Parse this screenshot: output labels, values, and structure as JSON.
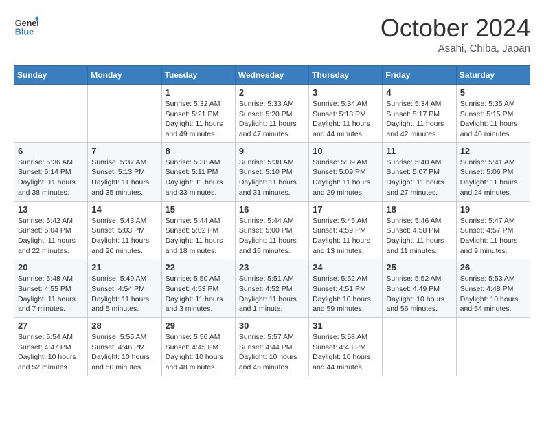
{
  "header": {
    "logo_line1": "General",
    "logo_line2": "Blue",
    "month_year": "October 2024",
    "location": "Asahi, Chiba, Japan"
  },
  "days_of_week": [
    "Sunday",
    "Monday",
    "Tuesday",
    "Wednesday",
    "Thursday",
    "Friday",
    "Saturday"
  ],
  "weeks": [
    [
      {
        "day": "",
        "sunrise": "",
        "sunset": "",
        "daylight": ""
      },
      {
        "day": "",
        "sunrise": "",
        "sunset": "",
        "daylight": ""
      },
      {
        "day": "1",
        "sunrise": "Sunrise: 5:32 AM",
        "sunset": "Sunset: 5:21 PM",
        "daylight": "Daylight: 11 hours and 49 minutes."
      },
      {
        "day": "2",
        "sunrise": "Sunrise: 5:33 AM",
        "sunset": "Sunset: 5:20 PM",
        "daylight": "Daylight: 11 hours and 47 minutes."
      },
      {
        "day": "3",
        "sunrise": "Sunrise: 5:34 AM",
        "sunset": "Sunset: 5:18 PM",
        "daylight": "Daylight: 11 hours and 44 minutes."
      },
      {
        "day": "4",
        "sunrise": "Sunrise: 5:34 AM",
        "sunset": "Sunset: 5:17 PM",
        "daylight": "Daylight: 11 hours and 42 minutes."
      },
      {
        "day": "5",
        "sunrise": "Sunrise: 5:35 AM",
        "sunset": "Sunset: 5:15 PM",
        "daylight": "Daylight: 11 hours and 40 minutes."
      }
    ],
    [
      {
        "day": "6",
        "sunrise": "Sunrise: 5:36 AM",
        "sunset": "Sunset: 5:14 PM",
        "daylight": "Daylight: 11 hours and 38 minutes."
      },
      {
        "day": "7",
        "sunrise": "Sunrise: 5:37 AM",
        "sunset": "Sunset: 5:13 PM",
        "daylight": "Daylight: 11 hours and 35 minutes."
      },
      {
        "day": "8",
        "sunrise": "Sunrise: 5:38 AM",
        "sunset": "Sunset: 5:11 PM",
        "daylight": "Daylight: 11 hours and 33 minutes."
      },
      {
        "day": "9",
        "sunrise": "Sunrise: 5:38 AM",
        "sunset": "Sunset: 5:10 PM",
        "daylight": "Daylight: 11 hours and 31 minutes."
      },
      {
        "day": "10",
        "sunrise": "Sunrise: 5:39 AM",
        "sunset": "Sunset: 5:09 PM",
        "daylight": "Daylight: 11 hours and 29 minutes."
      },
      {
        "day": "11",
        "sunrise": "Sunrise: 5:40 AM",
        "sunset": "Sunset: 5:07 PM",
        "daylight": "Daylight: 11 hours and 27 minutes."
      },
      {
        "day": "12",
        "sunrise": "Sunrise: 5:41 AM",
        "sunset": "Sunset: 5:06 PM",
        "daylight": "Daylight: 11 hours and 24 minutes."
      }
    ],
    [
      {
        "day": "13",
        "sunrise": "Sunrise: 5:42 AM",
        "sunset": "Sunset: 5:04 PM",
        "daylight": "Daylight: 11 hours and 22 minutes."
      },
      {
        "day": "14",
        "sunrise": "Sunrise: 5:43 AM",
        "sunset": "Sunset: 5:03 PM",
        "daylight": "Daylight: 11 hours and 20 minutes."
      },
      {
        "day": "15",
        "sunrise": "Sunrise: 5:44 AM",
        "sunset": "Sunset: 5:02 PM",
        "daylight": "Daylight: 11 hours and 18 minutes."
      },
      {
        "day": "16",
        "sunrise": "Sunrise: 5:44 AM",
        "sunset": "Sunset: 5:00 PM",
        "daylight": "Daylight: 11 hours and 16 minutes."
      },
      {
        "day": "17",
        "sunrise": "Sunrise: 5:45 AM",
        "sunset": "Sunset: 4:59 PM",
        "daylight": "Daylight: 11 hours and 13 minutes."
      },
      {
        "day": "18",
        "sunrise": "Sunrise: 5:46 AM",
        "sunset": "Sunset: 4:58 PM",
        "daylight": "Daylight: 11 hours and 11 minutes."
      },
      {
        "day": "19",
        "sunrise": "Sunrise: 5:47 AM",
        "sunset": "Sunset: 4:57 PM",
        "daylight": "Daylight: 11 hours and 9 minutes."
      }
    ],
    [
      {
        "day": "20",
        "sunrise": "Sunrise: 5:48 AM",
        "sunset": "Sunset: 4:55 PM",
        "daylight": "Daylight: 11 hours and 7 minutes."
      },
      {
        "day": "21",
        "sunrise": "Sunrise: 5:49 AM",
        "sunset": "Sunset: 4:54 PM",
        "daylight": "Daylight: 11 hours and 5 minutes."
      },
      {
        "day": "22",
        "sunrise": "Sunrise: 5:50 AM",
        "sunset": "Sunset: 4:53 PM",
        "daylight": "Daylight: 11 hours and 3 minutes."
      },
      {
        "day": "23",
        "sunrise": "Sunrise: 5:51 AM",
        "sunset": "Sunset: 4:52 PM",
        "daylight": "Daylight: 11 hours and 1 minute."
      },
      {
        "day": "24",
        "sunrise": "Sunrise: 5:52 AM",
        "sunset": "Sunset: 4:51 PM",
        "daylight": "Daylight: 10 hours and 59 minutes."
      },
      {
        "day": "25",
        "sunrise": "Sunrise: 5:52 AM",
        "sunset": "Sunset: 4:49 PM",
        "daylight": "Daylight: 10 hours and 56 minutes."
      },
      {
        "day": "26",
        "sunrise": "Sunrise: 5:53 AM",
        "sunset": "Sunset: 4:48 PM",
        "daylight": "Daylight: 10 hours and 54 minutes."
      }
    ],
    [
      {
        "day": "27",
        "sunrise": "Sunrise: 5:54 AM",
        "sunset": "Sunset: 4:47 PM",
        "daylight": "Daylight: 10 hours and 52 minutes."
      },
      {
        "day": "28",
        "sunrise": "Sunrise: 5:55 AM",
        "sunset": "Sunset: 4:46 PM",
        "daylight": "Daylight: 10 hours and 50 minutes."
      },
      {
        "day": "29",
        "sunrise": "Sunrise: 5:56 AM",
        "sunset": "Sunset: 4:45 PM",
        "daylight": "Daylight: 10 hours and 48 minutes."
      },
      {
        "day": "30",
        "sunrise": "Sunrise: 5:57 AM",
        "sunset": "Sunset: 4:44 PM",
        "daylight": "Daylight: 10 hours and 46 minutes."
      },
      {
        "day": "31",
        "sunrise": "Sunrise: 5:58 AM",
        "sunset": "Sunset: 4:43 PM",
        "daylight": "Daylight: 10 hours and 44 minutes."
      },
      {
        "day": "",
        "sunrise": "",
        "sunset": "",
        "daylight": ""
      },
      {
        "day": "",
        "sunrise": "",
        "sunset": "",
        "daylight": ""
      }
    ]
  ]
}
